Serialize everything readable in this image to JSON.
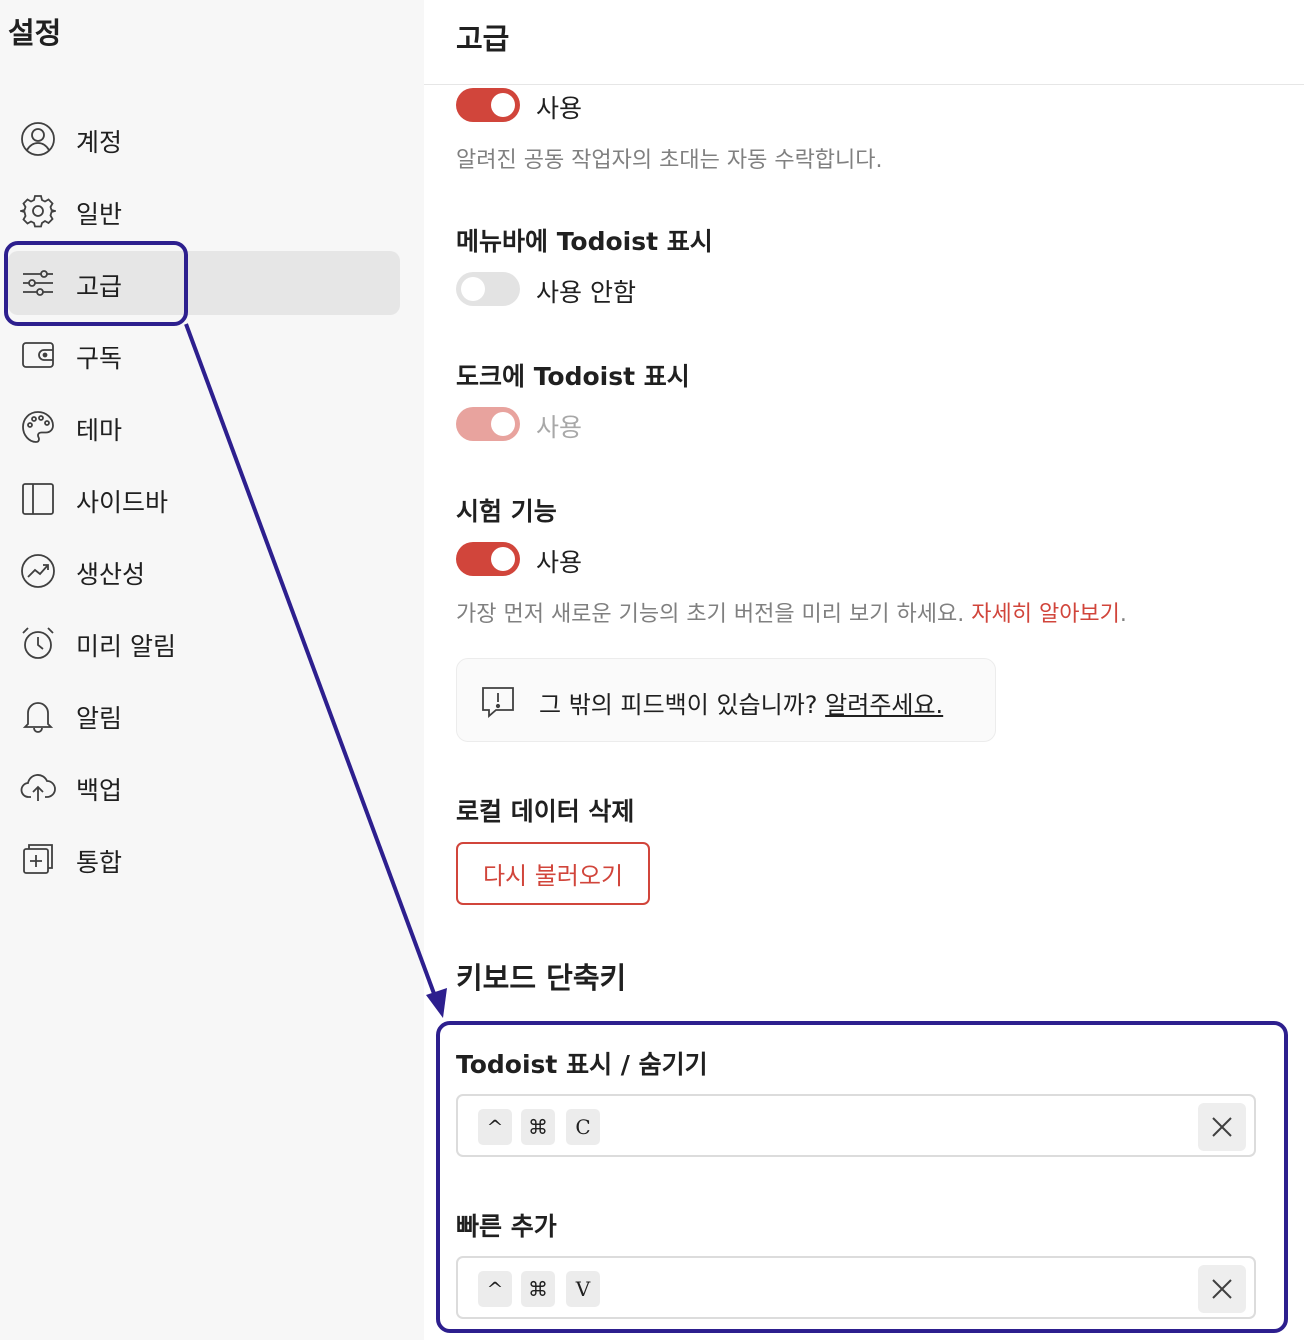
{
  "sidebar": {
    "title": "설정",
    "items": [
      {
        "label": "계정",
        "icon": "account-icon"
      },
      {
        "label": "일반",
        "icon": "gear-icon"
      },
      {
        "label": "고급",
        "icon": "sliders-icon",
        "active": true
      },
      {
        "label": "구독",
        "icon": "wallet-icon"
      },
      {
        "label": "테마",
        "icon": "palette-icon"
      },
      {
        "label": "사이드바",
        "icon": "sidebar-icon"
      },
      {
        "label": "생산성",
        "icon": "trend-icon"
      },
      {
        "label": "미리 알림",
        "icon": "alarm-clock-icon"
      },
      {
        "label": "알림",
        "icon": "bell-icon"
      },
      {
        "label": "백업",
        "icon": "cloud-upload-icon"
      },
      {
        "label": "통합",
        "icon": "plus-square-icon"
      }
    ]
  },
  "main": {
    "title": "고급",
    "auto_accept": {
      "toggle_label": "사용",
      "state": "on",
      "description": "알려진 공동 작업자의 초대는 자동 수락합니다."
    },
    "menubar": {
      "title": "메뉴바에 Todoist 표시",
      "toggle_label": "사용 안함",
      "state": "off"
    },
    "dock": {
      "title": "도크에 Todoist 표시",
      "toggle_label": "사용",
      "state": "disabled-on"
    },
    "experimental": {
      "title": "시험 기능",
      "toggle_label": "사용",
      "state": "on",
      "description": "가장 먼저 새로운 기능의 초기 버전을 미리 보기 하세요.",
      "link": "자세히 알아보기",
      "period": "."
    },
    "feedback": {
      "text": "그 밖의 피드백이 있습니까?",
      "link": "알려주세요."
    },
    "local_data": {
      "title": "로컬 데이터 삭제",
      "button": "다시 불러오기"
    },
    "shortcuts": {
      "title": "키보드 단축키",
      "items": [
        {
          "title": "Todoist 표시 / 숨기기",
          "keys": [
            "^",
            "⌘",
            "C"
          ]
        },
        {
          "title": "빠른 추가",
          "keys": [
            "^",
            "⌘",
            "V"
          ]
        }
      ]
    }
  },
  "colors": {
    "accent": "#d1453b",
    "annotation": "#2d1f8e"
  }
}
